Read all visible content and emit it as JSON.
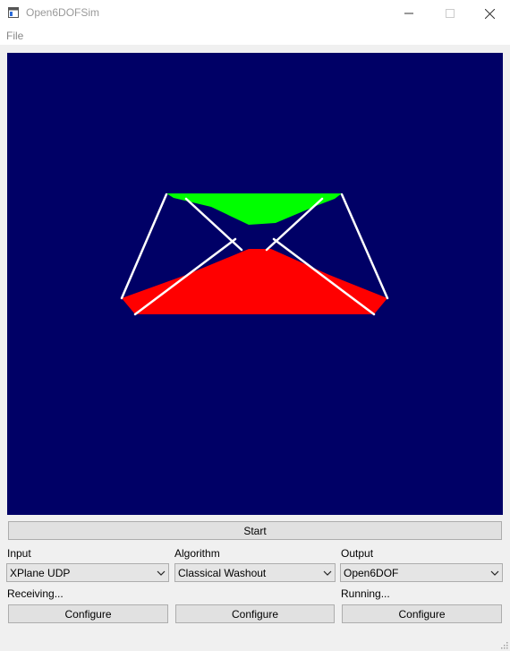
{
  "window": {
    "title": "Open6DOFSim"
  },
  "menu": {
    "file": "File"
  },
  "scene": {
    "background_color": "#000066",
    "top_platform_color": "#00ff00",
    "base_platform_color": "#ff0000",
    "actuator_color": "#ffffff"
  },
  "controls": {
    "start_label": "Start"
  },
  "input": {
    "label": "Input",
    "selected": "XPlane UDP",
    "status": "Receiving...",
    "configure_label": "Configure"
  },
  "algorithm": {
    "label": "Algorithm",
    "selected": "Classical Washout",
    "configure_label": "Configure"
  },
  "output": {
    "label": "Output",
    "selected": "Open6DOF",
    "status": "Running...",
    "configure_label": "Configure"
  }
}
